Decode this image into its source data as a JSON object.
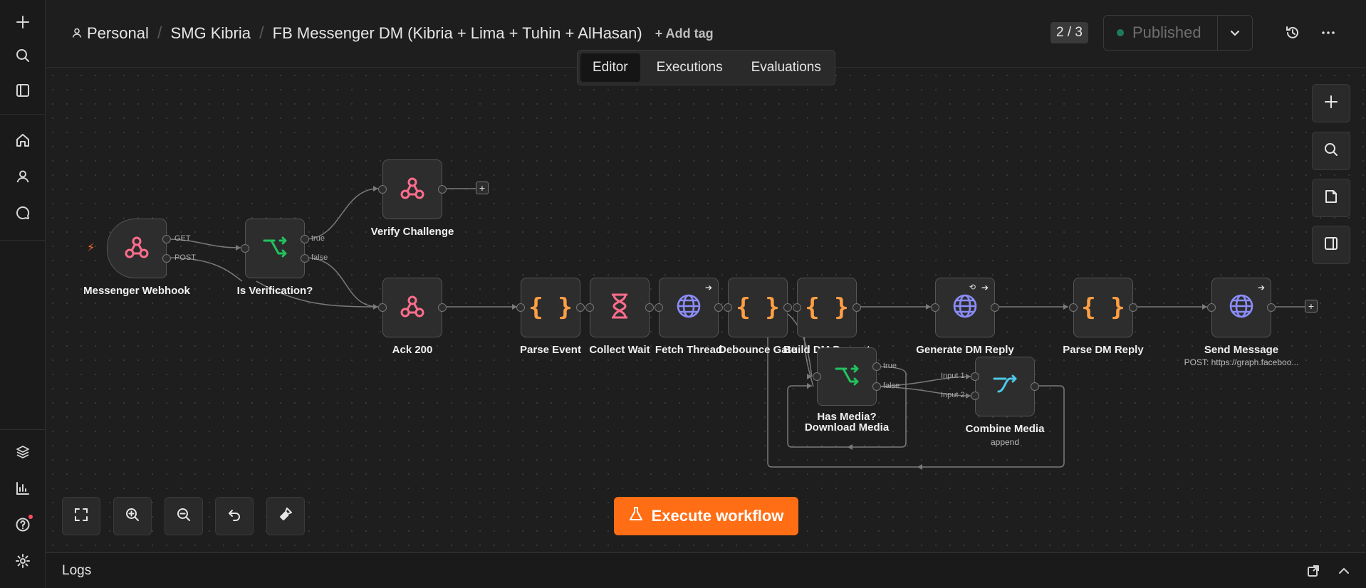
{
  "breadcrumb": {
    "personal": "Personal",
    "project": "SMG Kibria",
    "workflow": "FB Messenger DM (Kibria + Lima + Tuhin + AlHasan)",
    "add_tag": "+ Add tag"
  },
  "header": {
    "counter": "2 / 3",
    "publish_label": "Published"
  },
  "tabs": [
    {
      "label": "Editor",
      "active": true
    },
    {
      "label": "Executions",
      "active": false
    },
    {
      "label": "Evaluations",
      "active": false
    }
  ],
  "nodes": {
    "messenger_webhook": {
      "label": "Messenger Webhook",
      "outputs": [
        "GET",
        "POST"
      ]
    },
    "is_verification": {
      "label": "Is Verification?",
      "outputs": [
        "true",
        "false"
      ]
    },
    "verify_challenge": {
      "label": "Verify Challenge"
    },
    "ack_200": {
      "label": "Ack 200"
    },
    "parse_event": {
      "label": "Parse Event"
    },
    "collect_wait": {
      "label": "Collect Wait"
    },
    "fetch_thread": {
      "label": "Fetch Thread"
    },
    "debounce_gate": {
      "label": "Debounce Gate"
    },
    "build_dm_prompt": {
      "label": "Build DM Prompt"
    },
    "has_media": {
      "label": "Has Media?",
      "outputs": [
        "true",
        "false"
      ]
    },
    "download_media": {
      "label": "Download Media"
    },
    "combine_media": {
      "label": "Combine Media",
      "sub": "append",
      "inputs": [
        "Input 1",
        "Input 2"
      ]
    },
    "generate_dm_reply": {
      "label": "Generate DM Reply"
    },
    "parse_dm_reply": {
      "label": "Parse DM Reply"
    },
    "send_message": {
      "label": "Send Message",
      "sub": "POST: https://graph.faceboo..."
    }
  },
  "execute_button": "Execute workflow",
  "logs": {
    "title": "Logs"
  },
  "colors": {
    "accent": "#ff6d14",
    "webhook": "#ff6d8c",
    "if_node": "#21c35e",
    "code_node": "#ff9f45",
    "http_node": "#8b8cf8",
    "wait_node": "#ff6d8c",
    "merge_node": "#4ec9e8"
  },
  "icons": {
    "rail": [
      "plus-icon",
      "search-icon",
      "sidebar-icon",
      "home-icon",
      "user-icon",
      "chat-icon",
      "templates-icon",
      "insights-icon",
      "help-icon",
      "settings-icon"
    ],
    "right_tools": [
      "plus-icon",
      "search-icon",
      "sticky-note-icon",
      "panel-icon"
    ],
    "bottom_tools": [
      "fit-view-icon",
      "zoom-in-icon",
      "zoom-out-icon",
      "undo-icon",
      "tidy-up-icon"
    ]
  }
}
